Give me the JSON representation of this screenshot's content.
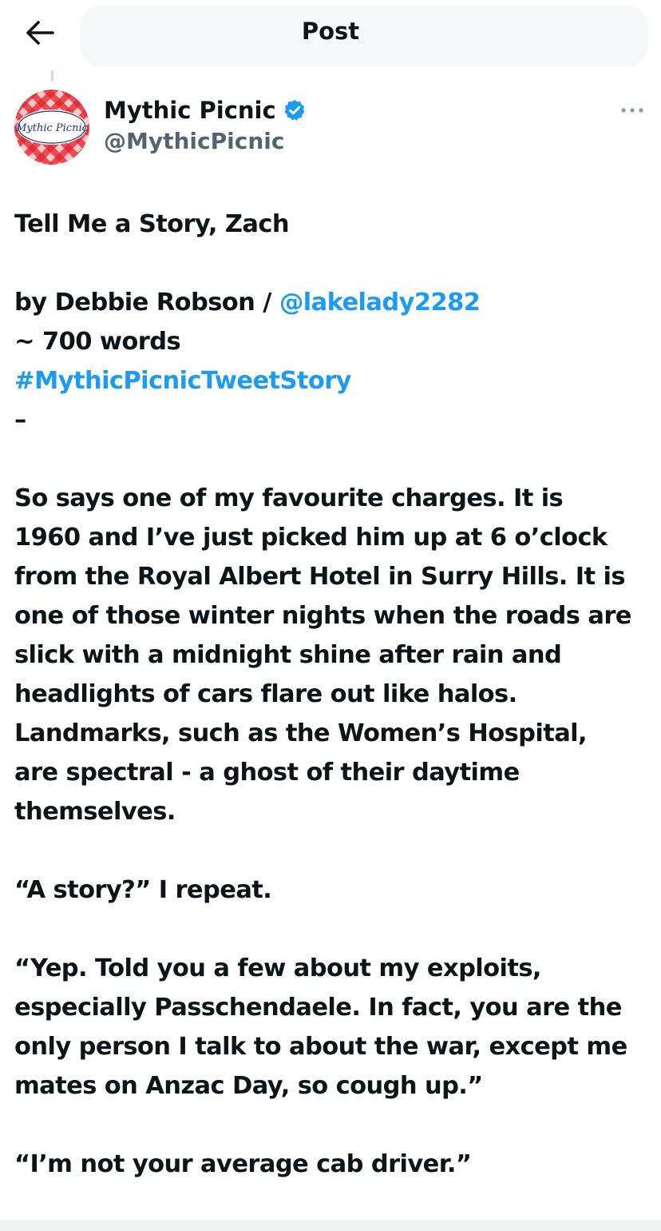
{
  "header": {
    "title": "Post",
    "back_icon": "arrow-left-icon"
  },
  "author": {
    "name": "Mythic Picnic",
    "handle": "@MythicPicnic",
    "avatar_text": "Mythic Picnic",
    "verified_icon": "verified-badge-icon",
    "more_icon": "more-horizontal-icon",
    "verified_color": "#1d9bf0"
  },
  "post": {
    "title": "Tell Me a Story, Zach",
    "byline_prefix": "by Debbie Robson / ",
    "byline_mention": "@lakelady2282",
    "word_count": "~ 700 words",
    "hashtag": "#MythicPicnicTweetStory",
    "separator": "–",
    "paragraph1": [
      "So says one of my favourite charges. It is",
      "1960 and I’ve just picked him up at 6 o’clock",
      "from the Royal Albert Hotel in Surry Hills. It is",
      "one of those winter nights when the roads are",
      "slick with a midnight shine after rain and",
      "headlights of cars flare out like halos.",
      "Landmarks, such as the Women’s Hospital,",
      "are spectral - a ghost of their daytime",
      "themselves."
    ],
    "paragraph2": "“A story?” I repeat.",
    "paragraph3": [
      "“Yep. Told you a few about my exploits,",
      "especially Passchendaele. In fact, you are the",
      "only person I talk to about the war, except me",
      "mates on Anzac Day, so cough up.”"
    ],
    "paragraph4": "“I’m not your average cab driver.”"
  },
  "colors": {
    "link": "#1d9bf0",
    "text": "#0f1419",
    "secondary": "#536471",
    "avatar_red": "#e2232b"
  }
}
